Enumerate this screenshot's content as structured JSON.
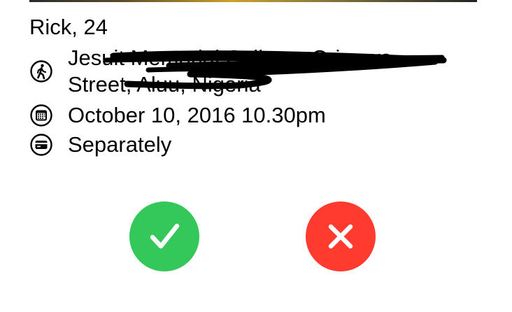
{
  "profile": {
    "name_age": "Rick, 24"
  },
  "details": {
    "location": {
      "icon": "walking-person-icon",
      "text": "Jesuit Memorial College, Orianwo Street, Aluu, Nigeria",
      "redacted": true
    },
    "datetime": {
      "icon": "calendar-icon",
      "text": "October 10, 2016  10.30pm"
    },
    "payment": {
      "icon": "card-icon",
      "text": "Separately"
    }
  },
  "actions": {
    "accept": {
      "icon": "checkmark-icon",
      "color": "#34c759"
    },
    "decline": {
      "icon": "close-icon",
      "color": "#ff3b30"
    }
  }
}
